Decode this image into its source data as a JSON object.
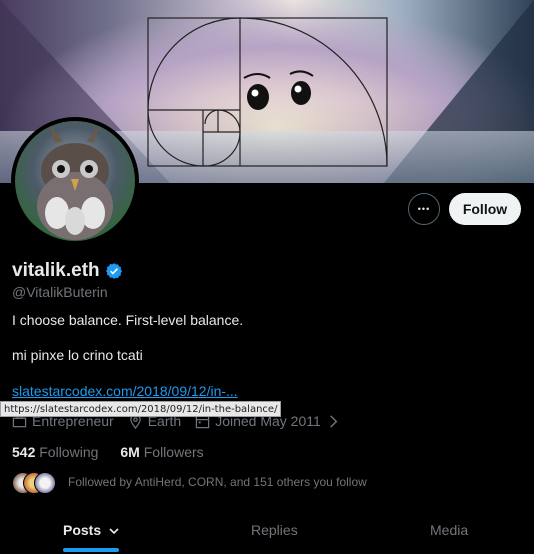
{
  "profile": {
    "display_name": "vitalik.eth",
    "handle": "@VitalikButerin",
    "bio_line1": "I choose balance. First-level balance.",
    "bio_line2": "mi pinxe lo crino tcati",
    "link_text": "slatestarcodex.com/2018/09/12/in-...",
    "verified": true,
    "verified_color": "#1d9bf0"
  },
  "actions": {
    "more_label": "•••",
    "follow_label": "Follow"
  },
  "meta": {
    "category": "Entrepreneur",
    "location": "Earth",
    "joined": "Joined May 2011"
  },
  "tooltip": {
    "url": "https://slatestarcodex.com/2018/09/12/in-the-balance/"
  },
  "stats": {
    "following_count": "542",
    "following_label": "Following",
    "followers_count": "6M",
    "followers_label": "Followers"
  },
  "followed_by": {
    "text": "Followed by AntiHerd, CORN, and 151 others you follow"
  },
  "tabs": [
    {
      "label": "Posts",
      "active": true
    },
    {
      "label": "Replies",
      "active": false
    },
    {
      "label": "Media",
      "active": false
    }
  ],
  "icons": [
    "more-icon",
    "verified-icon",
    "briefcase-icon",
    "location-icon",
    "calendar-icon",
    "chevron-right-icon",
    "chevron-down-icon"
  ],
  "colors": {
    "accent": "#1d9bf0",
    "background": "#000000",
    "muted": "#71767b"
  }
}
